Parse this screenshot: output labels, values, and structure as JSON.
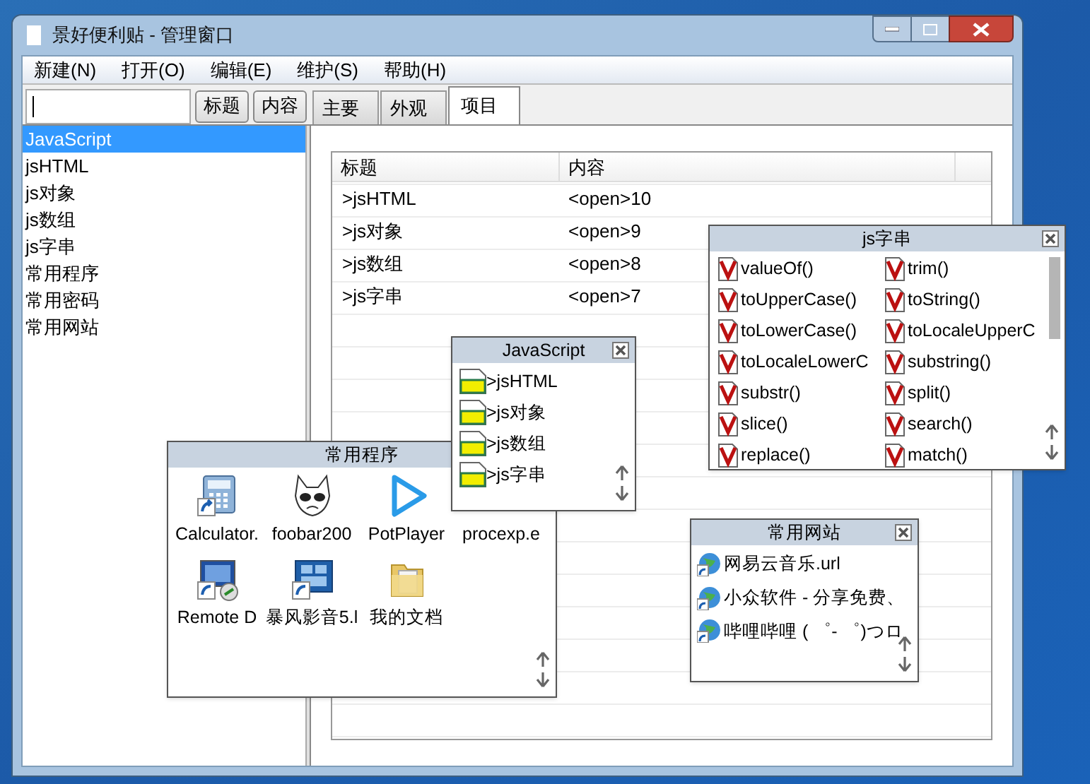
{
  "window": {
    "title": "景好便利贴 - 管理窗口"
  },
  "menu": [
    "新建(N)",
    "打开(O)",
    "编辑(E)",
    "维护(S)",
    "帮助(H)"
  ],
  "search_buttons": [
    "标题",
    "内容"
  ],
  "tabs": [
    {
      "label": "主要",
      "selected": false
    },
    {
      "label": "外观",
      "selected": false
    },
    {
      "label": "项目",
      "selected": true
    }
  ],
  "sidebar": {
    "items": [
      {
        "label": "JavaScript",
        "selected": true
      },
      {
        "label": "jsHTML",
        "selected": false
      },
      {
        "label": "js对象",
        "selected": false
      },
      {
        "label": "js数组",
        "selected": false
      },
      {
        "label": "js字串",
        "selected": false
      },
      {
        "label": "常用程序",
        "selected": false
      },
      {
        "label": "常用密码",
        "selected": false
      },
      {
        "label": "常用网站",
        "selected": false
      }
    ]
  },
  "table": {
    "columns": [
      "标题",
      "内容"
    ],
    "rows": [
      {
        "title": ">jsHTML",
        "content": "<open>10"
      },
      {
        "title": ">js对象",
        "content": "<open>9"
      },
      {
        "title": ">js数组",
        "content": "<open>8"
      },
      {
        "title": ">js字串",
        "content": "<open>7"
      }
    ]
  },
  "panels": [
    {
      "kind": "grid",
      "title": "常用程序",
      "items": [
        "Calculator.",
        "foobar200",
        "PotPlayer",
        "procexp.e",
        "Remote D",
        "暴风影音5.l",
        "我的文档"
      ]
    },
    {
      "kind": "notes",
      "title": "JavaScript",
      "items": [
        ">jsHTML",
        ">js对象",
        ">js数组",
        ">js字串"
      ]
    },
    {
      "kind": "methods",
      "title": "js字串",
      "items": [
        "valueOf()",
        "trim()",
        "toUpperCase()",
        "toString()",
        "toLowerCase()",
        "toLocaleUpperC",
        "toLocaleLowerC",
        "substring()",
        "substr()",
        "split()",
        "slice()",
        "search()",
        "replace()",
        "match()"
      ]
    },
    {
      "kind": "links",
      "title": "常用网站",
      "items": [
        "网易云音乐.url",
        "小众软件 - 分享免费、",
        "哔哩哔哩 ( ゜- ゜)つロ"
      ]
    }
  ]
}
